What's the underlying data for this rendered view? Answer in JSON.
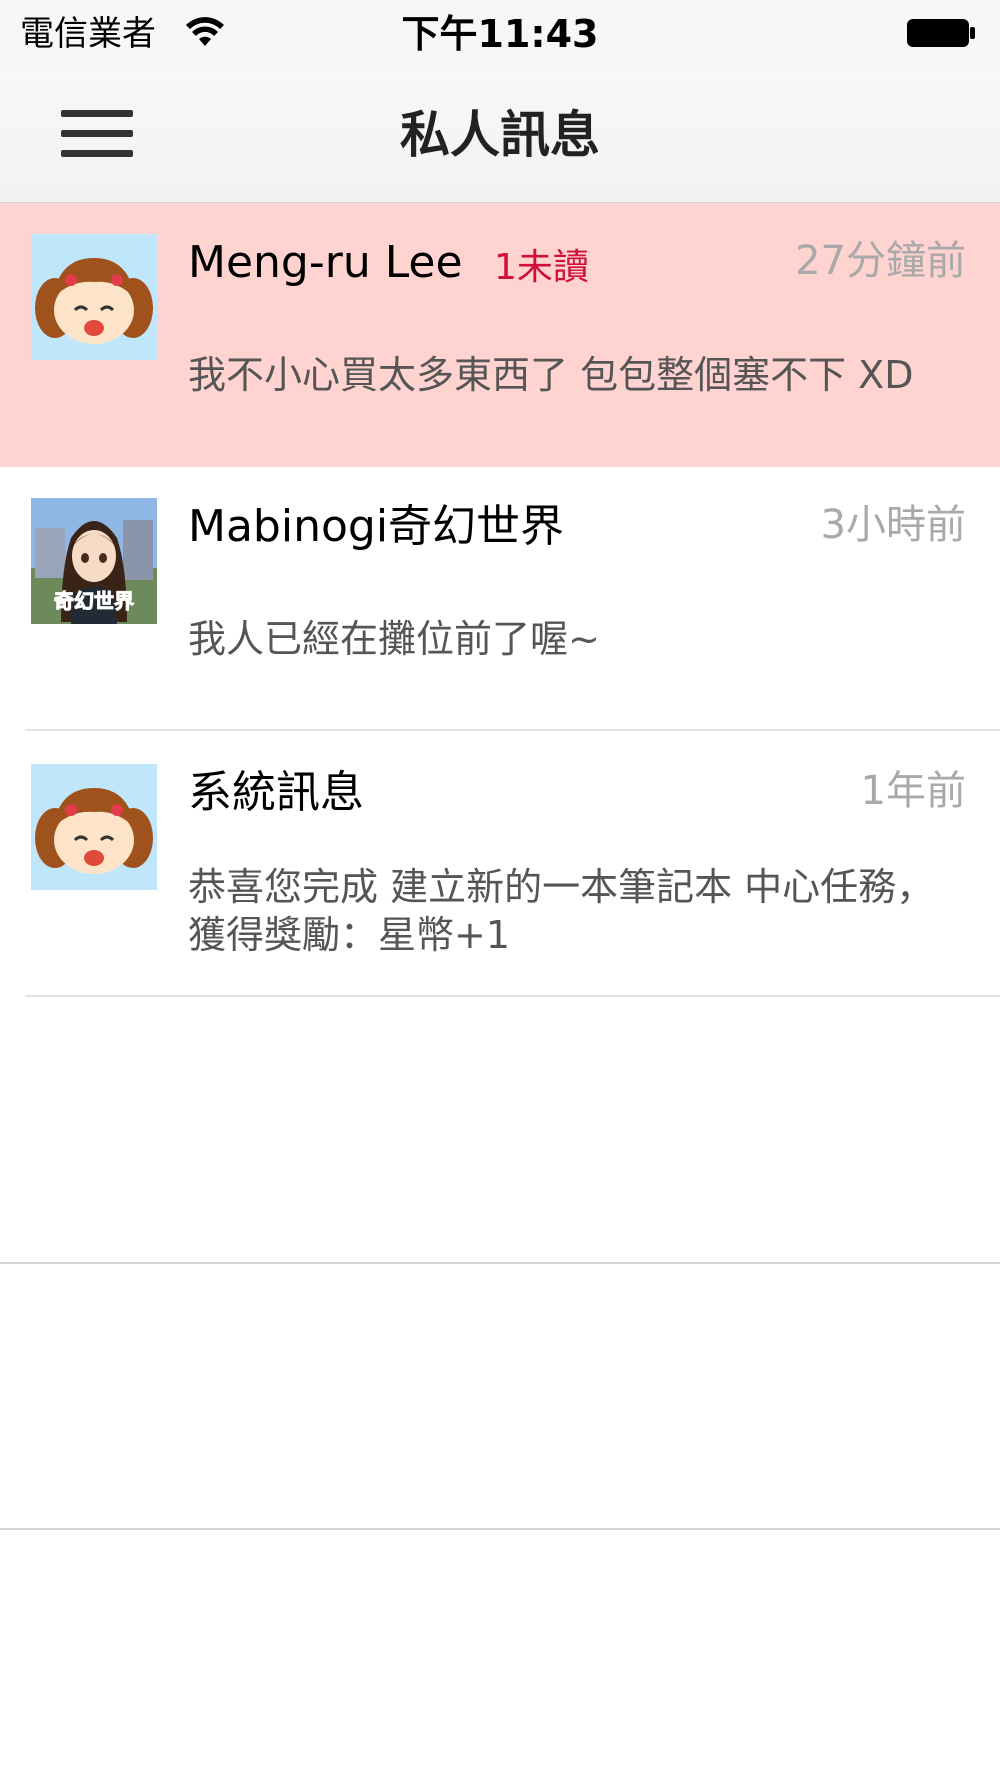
{
  "status_bar": {
    "carrier": "電信業者",
    "time": "下午11:43",
    "icons": [
      "wifi-icon",
      "battery-icon"
    ]
  },
  "nav_bar": {
    "title": "私人訊息",
    "menu_icon": "hamburger-menu-icon"
  },
  "colors": {
    "unread_row_bg": "#ffd3d0",
    "unread_badge": "#d0103a",
    "timestamp": "#a9a9a9",
    "preview_text": "#555555"
  },
  "messages": [
    {
      "sender": "Meng-ru Lee",
      "unread_badge": "1未讀",
      "time": "27分鐘前",
      "preview": "我不小心買太多東西了 包包整個塞不下 XD",
      "unread": true,
      "avatar": "cartoon-girl-avatar"
    },
    {
      "sender": "Mabinogi奇幻世界",
      "time": "3小時前",
      "preview": "我人已經在攤位前了喔~",
      "unread": false,
      "avatar": "anime-character-avatar",
      "avatar_text": "奇幻世界"
    },
    {
      "sender": "系統訊息",
      "time": "1年前",
      "preview": "恭喜您完成 建立新的一本筆記本 中心任務，獲得獎勵：星幣+1",
      "unread": false,
      "avatar": "cartoon-girl-avatar"
    }
  ]
}
